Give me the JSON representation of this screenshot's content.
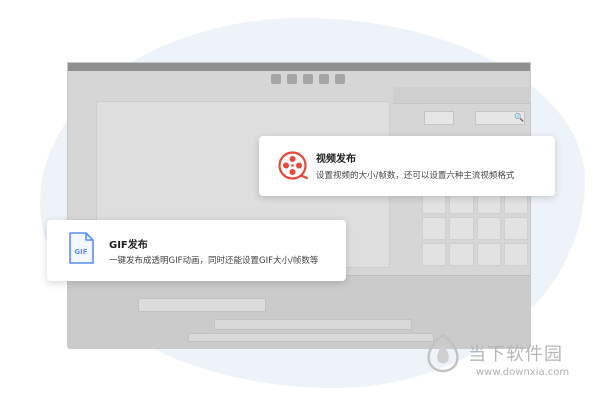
{
  "colors": {
    "accent_red": "#e8483a",
    "accent_blue": "#5b8ff9",
    "blob": "#eef2f9",
    "watermark": "#b7b7b7"
  },
  "cards": {
    "video": {
      "title": "视频发布",
      "desc": "设置视频的大小/帧数，还可以设置六种主流视频格式",
      "icon": "film-reel-icon"
    },
    "gif": {
      "title": "GIF发布",
      "desc": "一键发布成透明GIF动画，同时还能设置GIF大小/帧数等",
      "icon": "gif-file-icon",
      "icon_label": "GIF"
    }
  },
  "window": {
    "search_icon": "magnifier-icon",
    "search_glyph": "🔍"
  },
  "watermark": {
    "name": "当下软件园",
    "url": "www.downxia.com",
    "logo": "downxia-logo-icon"
  }
}
